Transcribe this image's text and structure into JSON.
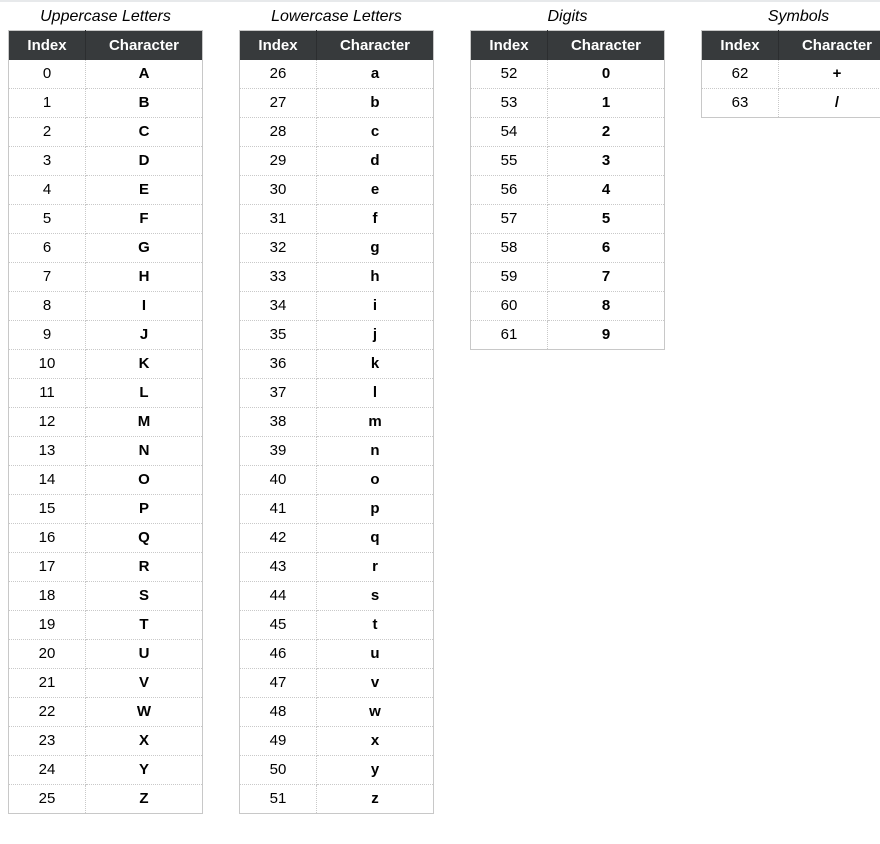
{
  "columns": {
    "index": "Index",
    "character": "Character"
  },
  "groups": [
    {
      "id": "uppercase",
      "title": "Uppercase Letters",
      "rows": [
        {
          "index": 0,
          "char": "A"
        },
        {
          "index": 1,
          "char": "B"
        },
        {
          "index": 2,
          "char": "C"
        },
        {
          "index": 3,
          "char": "D"
        },
        {
          "index": 4,
          "char": "E"
        },
        {
          "index": 5,
          "char": "F"
        },
        {
          "index": 6,
          "char": "G"
        },
        {
          "index": 7,
          "char": "H"
        },
        {
          "index": 8,
          "char": "I"
        },
        {
          "index": 9,
          "char": "J"
        },
        {
          "index": 10,
          "char": "K"
        },
        {
          "index": 11,
          "char": "L"
        },
        {
          "index": 12,
          "char": "M"
        },
        {
          "index": 13,
          "char": "N"
        },
        {
          "index": 14,
          "char": "O"
        },
        {
          "index": 15,
          "char": "P"
        },
        {
          "index": 16,
          "char": "Q"
        },
        {
          "index": 17,
          "char": "R"
        },
        {
          "index": 18,
          "char": "S"
        },
        {
          "index": 19,
          "char": "T"
        },
        {
          "index": 20,
          "char": "U"
        },
        {
          "index": 21,
          "char": "V"
        },
        {
          "index": 22,
          "char": "W"
        },
        {
          "index": 23,
          "char": "X"
        },
        {
          "index": 24,
          "char": "Y"
        },
        {
          "index": 25,
          "char": "Z"
        }
      ]
    },
    {
      "id": "lowercase",
      "title": "Lowercase Letters",
      "rows": [
        {
          "index": 26,
          "char": "a"
        },
        {
          "index": 27,
          "char": "b"
        },
        {
          "index": 28,
          "char": "c"
        },
        {
          "index": 29,
          "char": "d"
        },
        {
          "index": 30,
          "char": "e"
        },
        {
          "index": 31,
          "char": "f"
        },
        {
          "index": 32,
          "char": "g"
        },
        {
          "index": 33,
          "char": "h"
        },
        {
          "index": 34,
          "char": "i"
        },
        {
          "index": 35,
          "char": "j"
        },
        {
          "index": 36,
          "char": "k"
        },
        {
          "index": 37,
          "char": "l"
        },
        {
          "index": 38,
          "char": "m"
        },
        {
          "index": 39,
          "char": "n"
        },
        {
          "index": 40,
          "char": "o"
        },
        {
          "index": 41,
          "char": "p"
        },
        {
          "index": 42,
          "char": "q"
        },
        {
          "index": 43,
          "char": "r"
        },
        {
          "index": 44,
          "char": "s"
        },
        {
          "index": 45,
          "char": "t"
        },
        {
          "index": 46,
          "char": "u"
        },
        {
          "index": 47,
          "char": "v"
        },
        {
          "index": 48,
          "char": "w"
        },
        {
          "index": 49,
          "char": "x"
        },
        {
          "index": 50,
          "char": "y"
        },
        {
          "index": 51,
          "char": "z"
        }
      ]
    },
    {
      "id": "digits",
      "title": "Digits",
      "rows": [
        {
          "index": 52,
          "char": "0"
        },
        {
          "index": 53,
          "char": "1"
        },
        {
          "index": 54,
          "char": "2"
        },
        {
          "index": 55,
          "char": "3"
        },
        {
          "index": 56,
          "char": "4"
        },
        {
          "index": 57,
          "char": "5"
        },
        {
          "index": 58,
          "char": "6"
        },
        {
          "index": 59,
          "char": "7"
        },
        {
          "index": 60,
          "char": "8"
        },
        {
          "index": 61,
          "char": "9"
        }
      ]
    },
    {
      "id": "symbols",
      "title": "Symbols",
      "rows": [
        {
          "index": 62,
          "char": "+"
        },
        {
          "index": 63,
          "char": "/"
        }
      ]
    }
  ]
}
